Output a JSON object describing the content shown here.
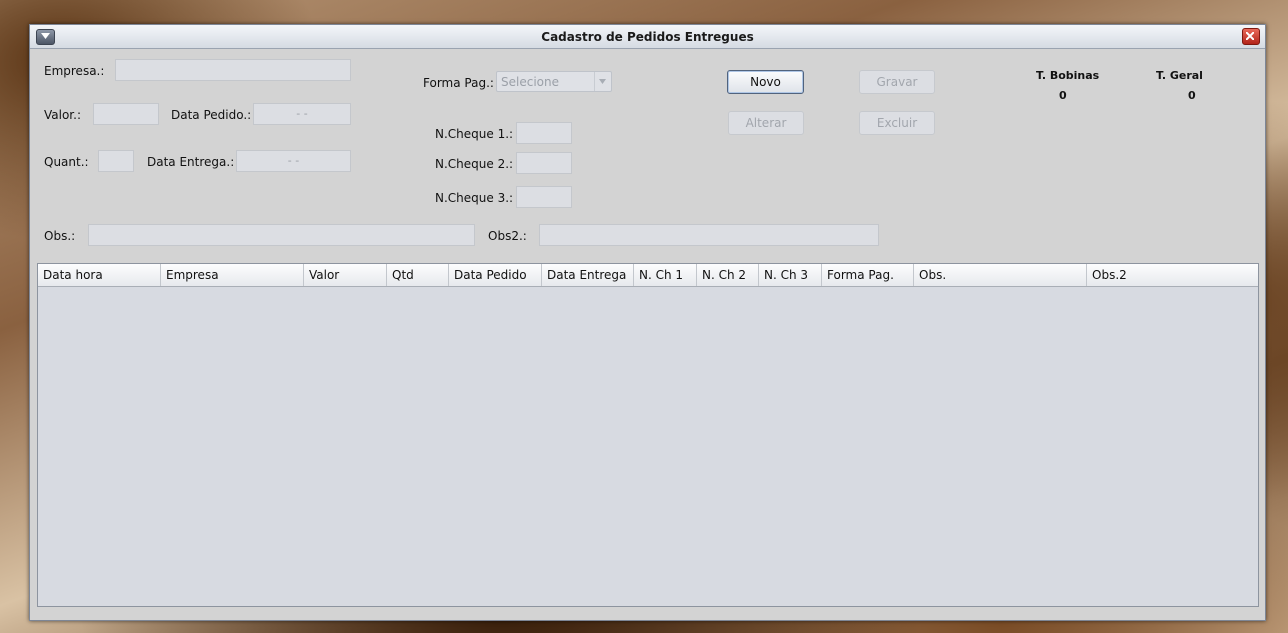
{
  "window": {
    "title": "Cadastro de Pedidos Entregues"
  },
  "form": {
    "empresa_label": "Empresa.:",
    "empresa_value": "",
    "valor_label": "Valor.:",
    "valor_value": "",
    "data_pedido_label": "Data Pedido.:",
    "data_pedido_value": "- -",
    "quant_label": "Quant.:",
    "quant_value": "",
    "data_entrega_label": "Data Entrega.:",
    "data_entrega_value": "- -",
    "forma_pag_label": "Forma Pag.:",
    "forma_pag_value": "Selecione",
    "ncheque1_label": "N.Cheque 1.:",
    "ncheque1_value": "",
    "ncheque2_label": "N.Cheque 2.:",
    "ncheque2_value": "",
    "ncheque3_label": "N.Cheque 3.:",
    "ncheque3_value": "",
    "obs_label": "Obs.:",
    "obs_value": "",
    "obs2_label": "Obs2.:",
    "obs2_value": ""
  },
  "buttons": {
    "novo": "Novo",
    "gravar": "Gravar",
    "alterar": "Alterar",
    "excluir": "Excluir"
  },
  "totals": {
    "bobinas_label": "T. Bobinas",
    "bobinas_value": "0",
    "geral_label": "T. Geral",
    "geral_value": "0"
  },
  "table": {
    "columns": [
      "Data hora",
      "Empresa",
      "Valor",
      "Qtd",
      "Data Pedido",
      "Data Entrega",
      "N. Ch 1",
      "N. Ch 2",
      "N. Ch 3",
      "Forma Pag.",
      "Obs.",
      "Obs.2"
    ],
    "rows": []
  },
  "colors": {
    "window_bg": "#d3d3d3",
    "close_button": "#c0392b",
    "table_bg": "#d7dae1"
  },
  "icons": {
    "menu": "chevron-down-icon",
    "close": "close-icon",
    "combo_arrow": "dropdown-arrow-icon"
  }
}
